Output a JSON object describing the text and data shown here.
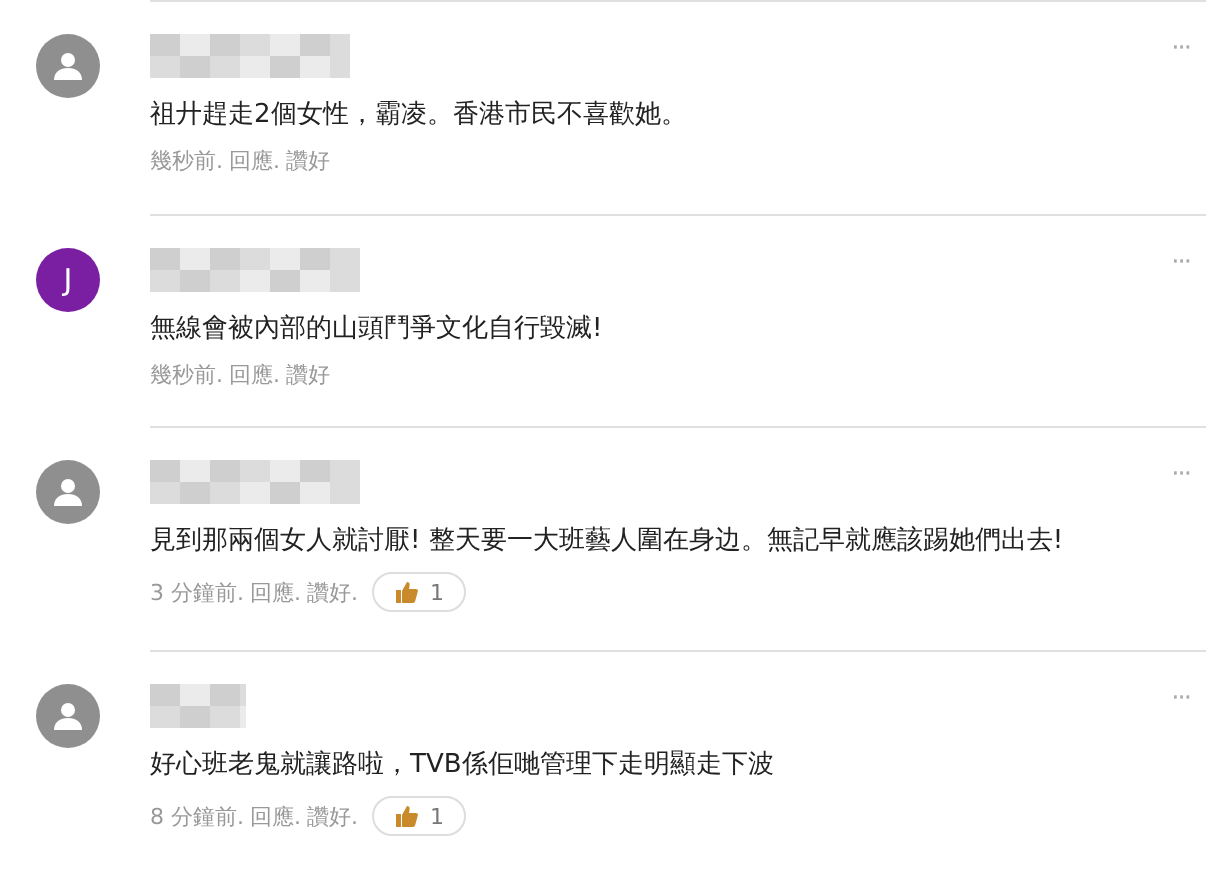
{
  "comments": [
    {
      "avatar": {
        "kind": "silhouette"
      },
      "text": "祖廾趕走2個女性，霸凌。香港市民不喜歡她。",
      "time": "幾秒前.",
      "actions": [
        "回應.",
        "讚好"
      ],
      "more": "···"
    },
    {
      "avatar": {
        "kind": "letter",
        "letter": "J",
        "color": "#7b1fa2"
      },
      "text": "無線會被內部的山頭鬥爭文化自行毀滅!",
      "time": "幾秒前.",
      "actions": [
        "回應.",
        "讚好"
      ],
      "more": "···"
    },
    {
      "avatar": {
        "kind": "silhouette"
      },
      "text": "見到那兩個女人就討厭! 整天要一大班藝人圍在身边。無記早就應該踢她們出去!",
      "time": "3 分鐘前.",
      "actions": [
        "回應.",
        "讚好."
      ],
      "likes": "1",
      "more": "···"
    },
    {
      "avatar": {
        "kind": "silhouette"
      },
      "text": "好心班老鬼就讓路啦，TVB係佢哋管理下走明顯走下波",
      "time": "8 分鐘前.",
      "actions": [
        "回應.",
        "讚好."
      ],
      "likes": "1",
      "more": "···"
    }
  ]
}
